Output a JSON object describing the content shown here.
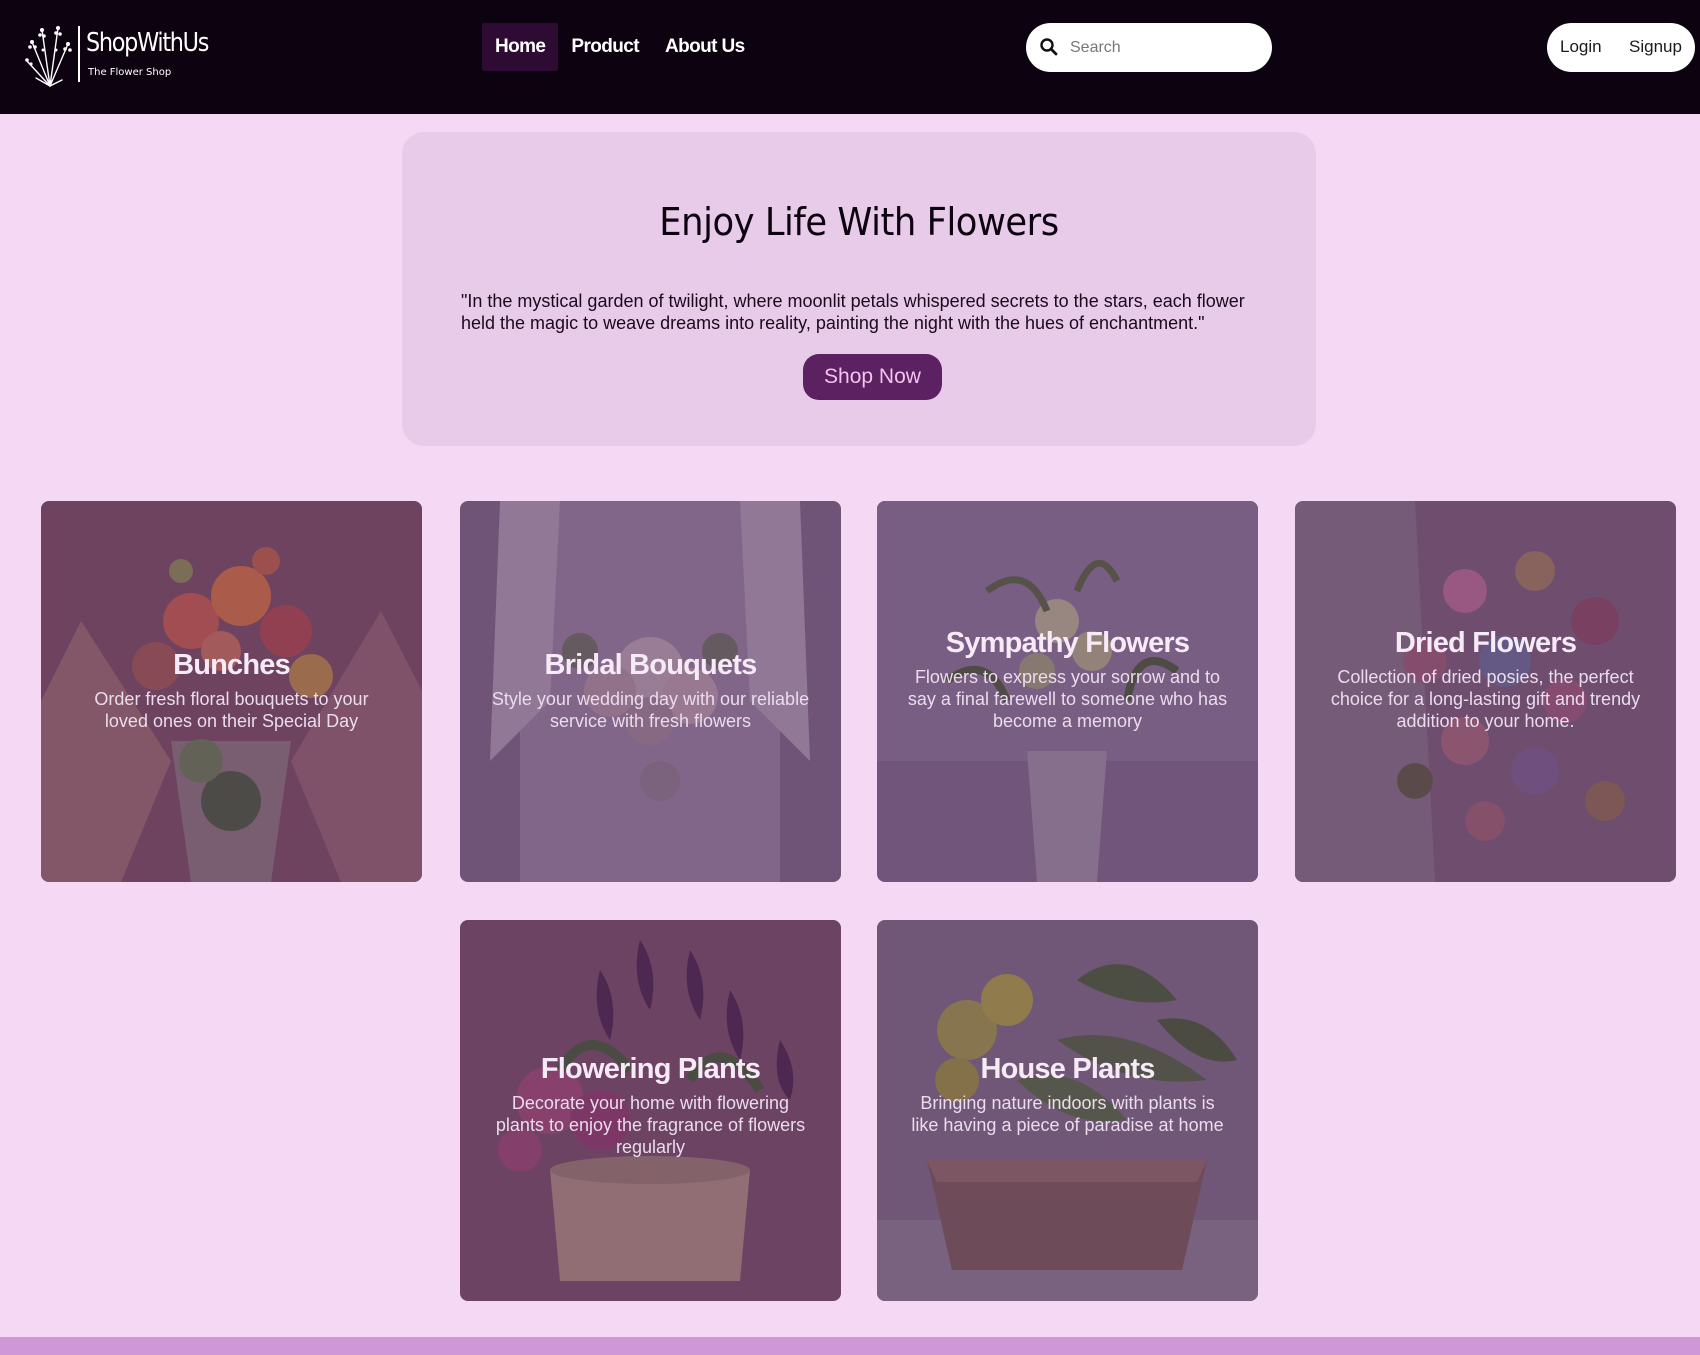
{
  "brand": {
    "name": "ShopWithUs",
    "tagline": "The Flower Shop",
    "icon": "lavender-sprig-icon"
  },
  "nav": {
    "items": [
      {
        "label": "Home",
        "active": true
      },
      {
        "label": "Product",
        "active": false
      },
      {
        "label": "About Us",
        "active": false
      }
    ]
  },
  "search": {
    "placeholder": "Search",
    "value": "",
    "icon": "search-icon"
  },
  "auth": {
    "login_label": "Login",
    "signup_label": "Signup"
  },
  "hero": {
    "title": "Enjoy Life With Flowers",
    "quote": "\"In the mystical garden of twilight, where moonlit petals whispered secrets to the stars, each flower held the magic to weave dreams into reality, painting the night with the hues of enchantment.\"",
    "cta_label": "Shop Now"
  },
  "categories": [
    {
      "title": "Bunches",
      "description": "Order fresh floral bouquets to your loved ones on their Special Day"
    },
    {
      "title": "Bridal Bouquets",
      "description": "Style your wedding day with our reliable service with fresh flowers"
    },
    {
      "title": "Sympathy Flowers",
      "description": "Flowers to express your sorrow and to say a final farewell to someone who has become a memory"
    },
    {
      "title": "Dried Flowers",
      "description": "Collection of dried posies, the perfect choice for a long-lasting gift and trendy addition to your home."
    },
    {
      "title": "Flowering Plants",
      "description": "Decorate your home with flowering plants to enjoy the fragrance of flowers regularly"
    },
    {
      "title": "House Plants",
      "description": "Bringing nature indoors with plants is like having a piece of paradise at home"
    }
  ],
  "colors": {
    "page_background": "#f4d8f4",
    "navbar_background": "#0d020f",
    "nav_active": "#2e0b32",
    "hero_background": "#e8cbe9",
    "cta_background": "#5b2160",
    "cta_text": "#f3c2ee",
    "footer_bar": "#cf97d6"
  }
}
